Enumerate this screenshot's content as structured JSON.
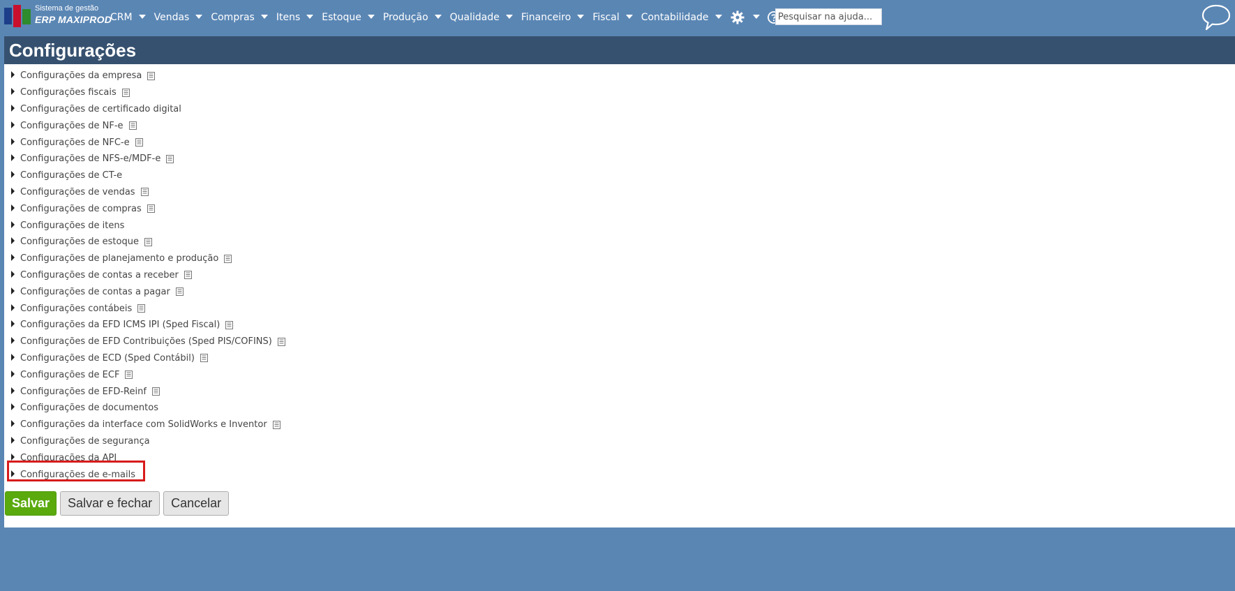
{
  "app": {
    "logo_line1": "Sistema de gestão",
    "logo_line2": "ERP MAXIPROD"
  },
  "nav": {
    "items": [
      {
        "label": "CRM"
      },
      {
        "label": "Vendas"
      },
      {
        "label": "Compras"
      },
      {
        "label": "Itens"
      },
      {
        "label": "Estoque"
      },
      {
        "label": "Produção"
      },
      {
        "label": "Qualidade"
      },
      {
        "label": "Financeiro"
      },
      {
        "label": "Fiscal"
      },
      {
        "label": "Contabilidade"
      }
    ],
    "icons": [
      "gear-icon",
      "help-icon"
    ],
    "search_placeholder": "Pesquisar na ajuda...",
    "chat_icon": "speech-bubble-icon"
  },
  "page": {
    "title": "Configurações"
  },
  "sections": [
    {
      "label": "Configurações da empresa",
      "has_doc_icon": true
    },
    {
      "label": "Configurações fiscais",
      "has_doc_icon": true
    },
    {
      "label": "Configurações de certificado digital",
      "has_doc_icon": false
    },
    {
      "label": "Configurações de NF-e",
      "has_doc_icon": true
    },
    {
      "label": "Configurações de NFC-e",
      "has_doc_icon": true
    },
    {
      "label": "Configurações de NFS-e/MDF-e",
      "has_doc_icon": true
    },
    {
      "label": "Configurações de CT-e",
      "has_doc_icon": false
    },
    {
      "label": "Configurações de vendas",
      "has_doc_icon": true
    },
    {
      "label": "Configurações de compras",
      "has_doc_icon": true
    },
    {
      "label": "Configurações de itens",
      "has_doc_icon": false
    },
    {
      "label": "Configurações de estoque",
      "has_doc_icon": true
    },
    {
      "label": "Configurações de planejamento e produção",
      "has_doc_icon": true
    },
    {
      "label": "Configurações de contas a receber",
      "has_doc_icon": true
    },
    {
      "label": "Configurações de contas a pagar",
      "has_doc_icon": true
    },
    {
      "label": "Configurações contábeis",
      "has_doc_icon": true
    },
    {
      "label": "Configurações da EFD ICMS IPI (Sped Fiscal)",
      "has_doc_icon": true
    },
    {
      "label": "Configurações de EFD Contribuições (Sped PIS/COFINS)",
      "has_doc_icon": true
    },
    {
      "label": "Configurações de ECD (Sped Contábil)",
      "has_doc_icon": true
    },
    {
      "label": "Configurações de ECF",
      "has_doc_icon": true
    },
    {
      "label": "Configurações de EFD-Reinf",
      "has_doc_icon": true
    },
    {
      "label": "Configurações de documentos",
      "has_doc_icon": false
    },
    {
      "label": "Configurações da interface com SolidWorks e Inventor",
      "has_doc_icon": true
    },
    {
      "label": "Configurações de segurança",
      "has_doc_icon": false
    },
    {
      "label": "Configurações da API",
      "has_doc_icon": false
    },
    {
      "label": "Configurações de e-mails",
      "has_doc_icon": false,
      "highlighted": true
    }
  ],
  "actions": {
    "save": "Salvar",
    "save_close": "Salvar e fechar",
    "cancel": "Cancelar"
  },
  "colors": {
    "background": "#5a86b4",
    "header": "#36516f",
    "primary_button": "#5aaa0e",
    "highlight": "#d71b1b"
  }
}
